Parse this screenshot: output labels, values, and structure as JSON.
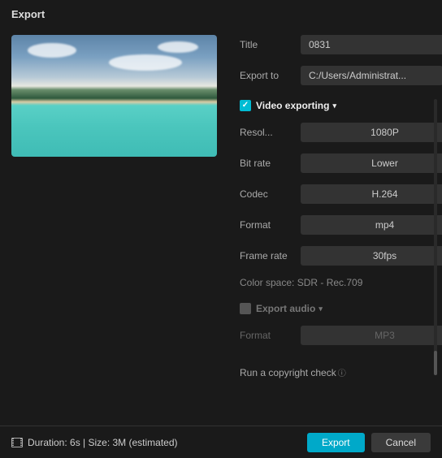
{
  "header": {
    "title": "Export"
  },
  "fields": {
    "title_label": "Title",
    "title_value": "0831",
    "export_to_label": "Export to",
    "export_to_value": "C:/Users/Administrat..."
  },
  "video": {
    "section_label": "Video exporting",
    "checked": true,
    "resolution_label": "Resol...",
    "resolution_value": "1080P",
    "bitrate_label": "Bit rate",
    "bitrate_value": "Lower",
    "codec_label": "Codec",
    "codec_value": "H.264",
    "format_label": "Format",
    "format_value": "mp4",
    "fps_label": "Frame rate",
    "fps_value": "30fps",
    "color_space": "Color space: SDR - Rec.709"
  },
  "audio": {
    "section_label": "Export audio",
    "checked": false,
    "format_label": "Format",
    "format_value": "MP3"
  },
  "copyright": {
    "label": "Run a copyright check",
    "enabled": false
  },
  "footer": {
    "status": "Duration: 6s | Size: 3M (estimated)",
    "export_label": "Export",
    "cancel_label": "Cancel"
  },
  "icons": {
    "folder": "folder-icon",
    "chevron": "chevron-down-icon",
    "film": "film-icon",
    "help": "help-icon"
  }
}
